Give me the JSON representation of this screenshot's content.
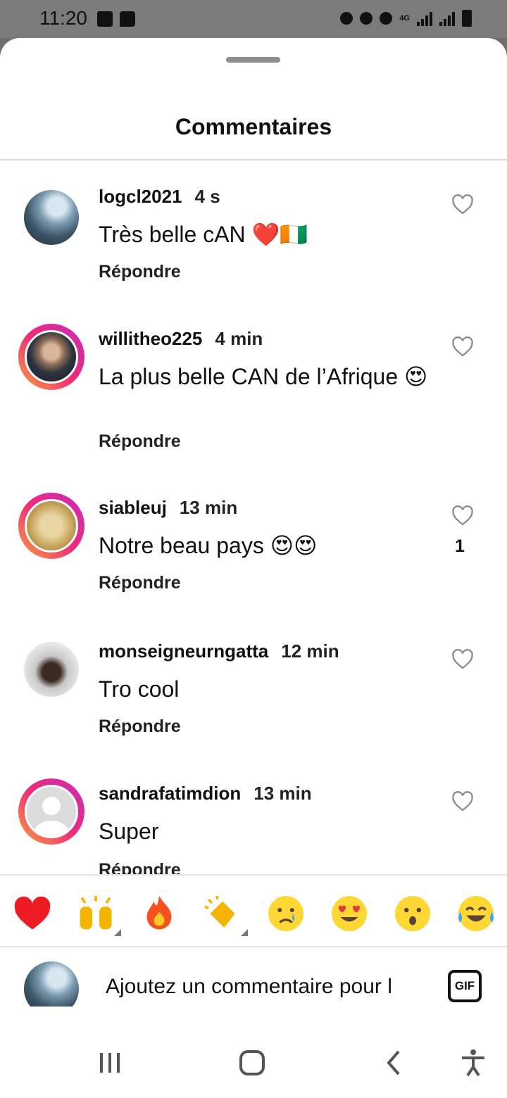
{
  "status_bar": {
    "time": "11:20",
    "left_icons": [
      "facebook-icon",
      "messenger-icon"
    ],
    "right_icons": [
      "battery-saver-icon",
      "alarm-icon",
      "mute-icon",
      "4g-icon",
      "signal-icon",
      "signal-icon",
      "battery-icon"
    ],
    "network_label": "4G"
  },
  "sheet": {
    "title": "Commentaires"
  },
  "comments": [
    {
      "username": "logcl2021",
      "time": "4 s",
      "text": "Très belle cAN ❤️🇨🇮",
      "reply_label": "Répondre",
      "likes": "",
      "avatar_ring": false
    },
    {
      "username": "willitheo225",
      "time": "4 min",
      "text": "La plus belle CAN de l’Afrique 😍",
      "reply_label": "Répondre",
      "likes": "",
      "avatar_ring": true
    },
    {
      "username": "siableuj",
      "time": "13 min",
      "text": "Notre beau pays 😍😍",
      "reply_label": "Répondre",
      "likes": "1",
      "avatar_ring": true
    },
    {
      "username": "monseigneurngatta",
      "time": "12 min",
      "text": "Tro cool",
      "reply_label": "Répondre",
      "likes": "",
      "avatar_ring": false
    },
    {
      "username": "sandrafatimdion",
      "time": "13 min",
      "text": "Super",
      "reply_label": "Répondre",
      "likes": "",
      "avatar_ring": true
    }
  ],
  "quick_reactions": [
    {
      "emoji": "❤️",
      "has_variants": false
    },
    {
      "emoji": "🙌",
      "has_variants": true
    },
    {
      "emoji": "🔥",
      "has_variants": false
    },
    {
      "emoji": "👏",
      "has_variants": true
    },
    {
      "emoji": "😢",
      "has_variants": false
    },
    {
      "emoji": "😍",
      "has_variants": false
    },
    {
      "emoji": "😮",
      "has_variants": false
    },
    {
      "emoji": "😂",
      "has_variants": false
    }
  ],
  "comment_input": {
    "placeholder": "Ajoutez un commentaire pour l",
    "value": "",
    "gif_label": "GIF"
  },
  "nav_bar": {
    "buttons": [
      "recent-apps-icon",
      "home-icon",
      "back-icon",
      "accessibility-icon"
    ]
  },
  "colors": {
    "heart_red": "#ed1c24",
    "ring_gradient": [
      "#f9a33a",
      "#ee2a7b",
      "#c82dbb"
    ],
    "divider": "#dbdbdb"
  }
}
